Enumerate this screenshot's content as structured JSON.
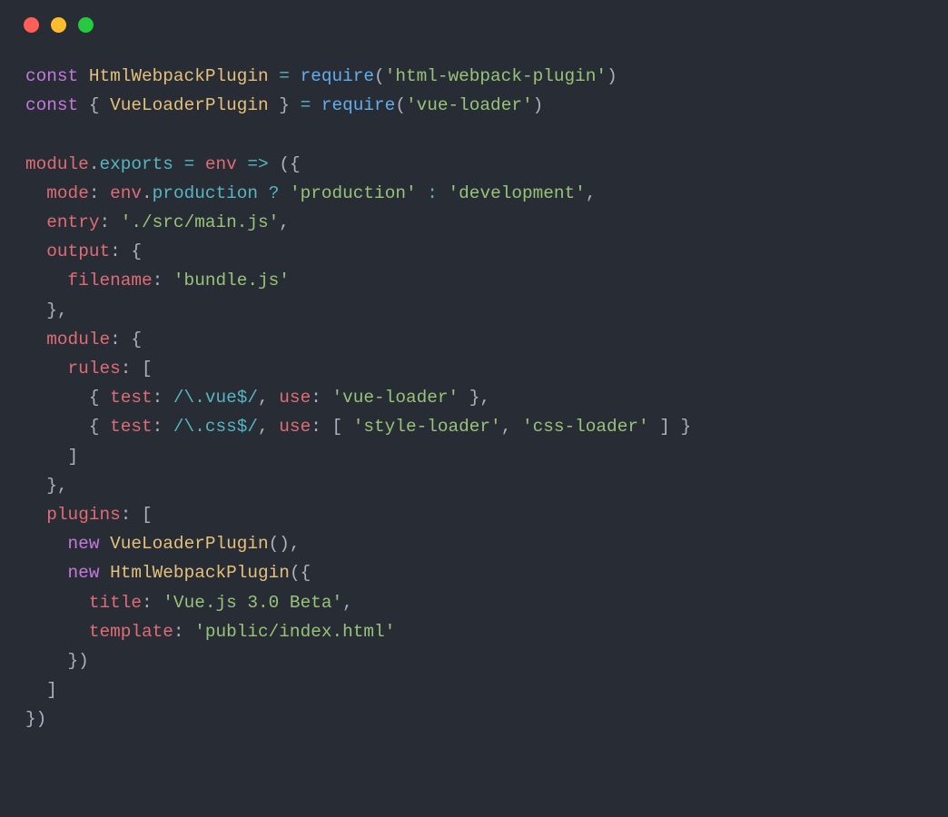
{
  "traffic_lights": [
    "close",
    "minimize",
    "zoom"
  ],
  "code": {
    "lines": [
      [
        {
          "t": "const",
          "c": "c-keyword"
        },
        {
          "t": " ",
          "c": "c-punc"
        },
        {
          "t": "HtmlWebpackPlugin",
          "c": "c-def"
        },
        {
          "t": " ",
          "c": "c-punc"
        },
        {
          "t": "=",
          "c": "c-op"
        },
        {
          "t": " ",
          "c": "c-punc"
        },
        {
          "t": "require",
          "c": "c-call"
        },
        {
          "t": "(",
          "c": "c-punc"
        },
        {
          "t": "'html-webpack-plugin'",
          "c": "c-string"
        },
        {
          "t": ")",
          "c": "c-punc"
        }
      ],
      [
        {
          "t": "const",
          "c": "c-keyword"
        },
        {
          "t": " ",
          "c": "c-punc"
        },
        {
          "t": "{ ",
          "c": "c-punc"
        },
        {
          "t": "VueLoaderPlugin",
          "c": "c-def"
        },
        {
          "t": " } ",
          "c": "c-punc"
        },
        {
          "t": "=",
          "c": "c-op"
        },
        {
          "t": " ",
          "c": "c-punc"
        },
        {
          "t": "require",
          "c": "c-call"
        },
        {
          "t": "(",
          "c": "c-punc"
        },
        {
          "t": "'vue-loader'",
          "c": "c-string"
        },
        {
          "t": ")",
          "c": "c-punc"
        }
      ],
      [],
      [
        {
          "t": "module",
          "c": "c-ident"
        },
        {
          "t": ".",
          "c": "c-punc"
        },
        {
          "t": "exports",
          "c": "c-prop"
        },
        {
          "t": " ",
          "c": "c-punc"
        },
        {
          "t": "=",
          "c": "c-op"
        },
        {
          "t": " ",
          "c": "c-punc"
        },
        {
          "t": "env",
          "c": "c-ident"
        },
        {
          "t": " ",
          "c": "c-punc"
        },
        {
          "t": "=>",
          "c": "c-op"
        },
        {
          "t": " ",
          "c": "c-punc"
        },
        {
          "t": "({",
          "c": "c-punc"
        }
      ],
      [
        {
          "t": "  ",
          "c": "c-punc"
        },
        {
          "t": "mode",
          "c": "c-ident"
        },
        {
          "t": ": ",
          "c": "c-punc"
        },
        {
          "t": "env",
          "c": "c-ident"
        },
        {
          "t": ".",
          "c": "c-punc"
        },
        {
          "t": "production",
          "c": "c-prop"
        },
        {
          "t": " ",
          "c": "c-punc"
        },
        {
          "t": "?",
          "c": "c-op"
        },
        {
          "t": " ",
          "c": "c-punc"
        },
        {
          "t": "'production'",
          "c": "c-string"
        },
        {
          "t": " ",
          "c": "c-punc"
        },
        {
          "t": ":",
          "c": "c-op"
        },
        {
          "t": " ",
          "c": "c-punc"
        },
        {
          "t": "'development'",
          "c": "c-string"
        },
        {
          "t": ",",
          "c": "c-punc"
        }
      ],
      [
        {
          "t": "  ",
          "c": "c-punc"
        },
        {
          "t": "entry",
          "c": "c-ident"
        },
        {
          "t": ": ",
          "c": "c-punc"
        },
        {
          "t": "'./src/main.js'",
          "c": "c-string"
        },
        {
          "t": ",",
          "c": "c-punc"
        }
      ],
      [
        {
          "t": "  ",
          "c": "c-punc"
        },
        {
          "t": "output",
          "c": "c-ident"
        },
        {
          "t": ": {",
          "c": "c-punc"
        }
      ],
      [
        {
          "t": "    ",
          "c": "c-punc"
        },
        {
          "t": "filename",
          "c": "c-ident"
        },
        {
          "t": ": ",
          "c": "c-punc"
        },
        {
          "t": "'bundle.js'",
          "c": "c-string"
        }
      ],
      [
        {
          "t": "  },",
          "c": "c-punc"
        }
      ],
      [
        {
          "t": "  ",
          "c": "c-punc"
        },
        {
          "t": "module",
          "c": "c-ident"
        },
        {
          "t": ": {",
          "c": "c-punc"
        }
      ],
      [
        {
          "t": "    ",
          "c": "c-punc"
        },
        {
          "t": "rules",
          "c": "c-ident"
        },
        {
          "t": ": [",
          "c": "c-punc"
        }
      ],
      [
        {
          "t": "      { ",
          "c": "c-punc"
        },
        {
          "t": "test",
          "c": "c-ident"
        },
        {
          "t": ": ",
          "c": "c-punc"
        },
        {
          "t": "/\\.vue$/",
          "c": "c-regex"
        },
        {
          "t": ", ",
          "c": "c-punc"
        },
        {
          "t": "use",
          "c": "c-ident"
        },
        {
          "t": ": ",
          "c": "c-punc"
        },
        {
          "t": "'vue-loader'",
          "c": "c-string"
        },
        {
          "t": " },",
          "c": "c-punc"
        }
      ],
      [
        {
          "t": "      { ",
          "c": "c-punc"
        },
        {
          "t": "test",
          "c": "c-ident"
        },
        {
          "t": ": ",
          "c": "c-punc"
        },
        {
          "t": "/\\.css$/",
          "c": "c-regex"
        },
        {
          "t": ", ",
          "c": "c-punc"
        },
        {
          "t": "use",
          "c": "c-ident"
        },
        {
          "t": ": [ ",
          "c": "c-punc"
        },
        {
          "t": "'style-loader'",
          "c": "c-string"
        },
        {
          "t": ", ",
          "c": "c-punc"
        },
        {
          "t": "'css-loader'",
          "c": "c-string"
        },
        {
          "t": " ] }",
          "c": "c-punc"
        }
      ],
      [
        {
          "t": "    ]",
          "c": "c-punc"
        }
      ],
      [
        {
          "t": "  },",
          "c": "c-punc"
        }
      ],
      [
        {
          "t": "  ",
          "c": "c-punc"
        },
        {
          "t": "plugins",
          "c": "c-ident"
        },
        {
          "t": ": [",
          "c": "c-punc"
        }
      ],
      [
        {
          "t": "    ",
          "c": "c-punc"
        },
        {
          "t": "new",
          "c": "c-keyword"
        },
        {
          "t": " ",
          "c": "c-punc"
        },
        {
          "t": "VueLoaderPlugin",
          "c": "c-def"
        },
        {
          "t": "(),",
          "c": "c-punc"
        }
      ],
      [
        {
          "t": "    ",
          "c": "c-punc"
        },
        {
          "t": "new",
          "c": "c-keyword"
        },
        {
          "t": " ",
          "c": "c-punc"
        },
        {
          "t": "HtmlWebpackPlugin",
          "c": "c-def"
        },
        {
          "t": "({",
          "c": "c-punc"
        }
      ],
      [
        {
          "t": "      ",
          "c": "c-punc"
        },
        {
          "t": "title",
          "c": "c-ident"
        },
        {
          "t": ": ",
          "c": "c-punc"
        },
        {
          "t": "'Vue.js 3.0 Beta'",
          "c": "c-string"
        },
        {
          "t": ",",
          "c": "c-punc"
        }
      ],
      [
        {
          "t": "      ",
          "c": "c-punc"
        },
        {
          "t": "template",
          "c": "c-ident"
        },
        {
          "t": ": ",
          "c": "c-punc"
        },
        {
          "t": "'public/index.html'",
          "c": "c-string"
        }
      ],
      [
        {
          "t": "    })",
          "c": "c-punc"
        }
      ],
      [
        {
          "t": "  ]",
          "c": "c-punc"
        }
      ],
      [
        {
          "t": "})",
          "c": "c-punc"
        }
      ]
    ]
  }
}
